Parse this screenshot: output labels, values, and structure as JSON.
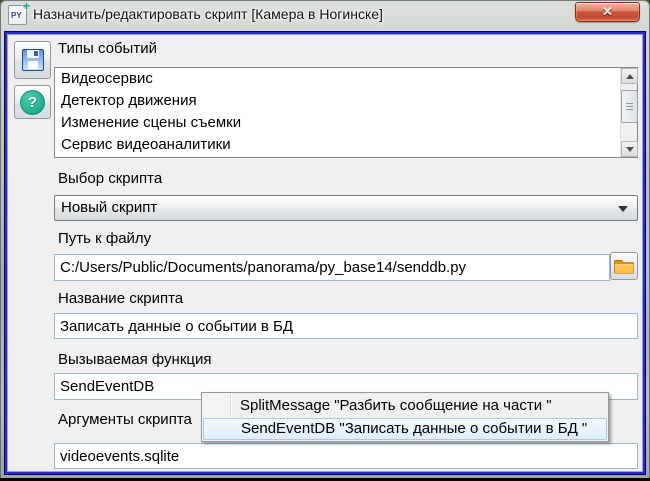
{
  "titlebar": {
    "title": "Назначить/редактировать скрипт [Камера в Ногинске]",
    "app_icon_text": "PY",
    "app_icon_plus": "+"
  },
  "icons": {
    "close_glyph": "✕",
    "help_glyph": "?",
    "save": "floppy-disk",
    "folder_browse": "folder",
    "combo_arrow": "triangle-down",
    "scroll_up": "triangle-up",
    "scroll_down": "triangle-down"
  },
  "event_types": {
    "label": "Типы событий",
    "items": [
      "Видеосервис",
      "Детектор движения",
      "Изменение сцены съемки",
      "Сервис видеоаналитики"
    ]
  },
  "script_select": {
    "label": "Выбор скрипта",
    "value": "Новый скрипт"
  },
  "file_path": {
    "label": "Путь к файлу",
    "value": "C:/Users/Public/Documents/panorama/py_base14/senddb.py"
  },
  "script_name": {
    "label": "Название скрипта",
    "value": "Записать данные о событии в БД"
  },
  "function": {
    "label": "Вызываемая функция",
    "value": "SendEventDB"
  },
  "arguments": {
    "label": "Аргументы скрипта",
    "value": "videoevents.sqlite"
  },
  "autocomplete": {
    "items": [
      {
        "text": "SplitMessage \"Разбить сообщение на части \"",
        "selected": false
      },
      {
        "text": "SendEventDB \"Записать данные о событии в БД \"",
        "selected": true
      }
    ]
  },
  "colors": {
    "dialog_border": "#2b2bc6",
    "close_red": "#cc553c",
    "help_teal": "#1fae8e",
    "save_blue": "#5a94dd",
    "folder_orange": "#f5a623",
    "selection_blue": "#e0eefb",
    "client_bg": "#f0f0f0"
  }
}
